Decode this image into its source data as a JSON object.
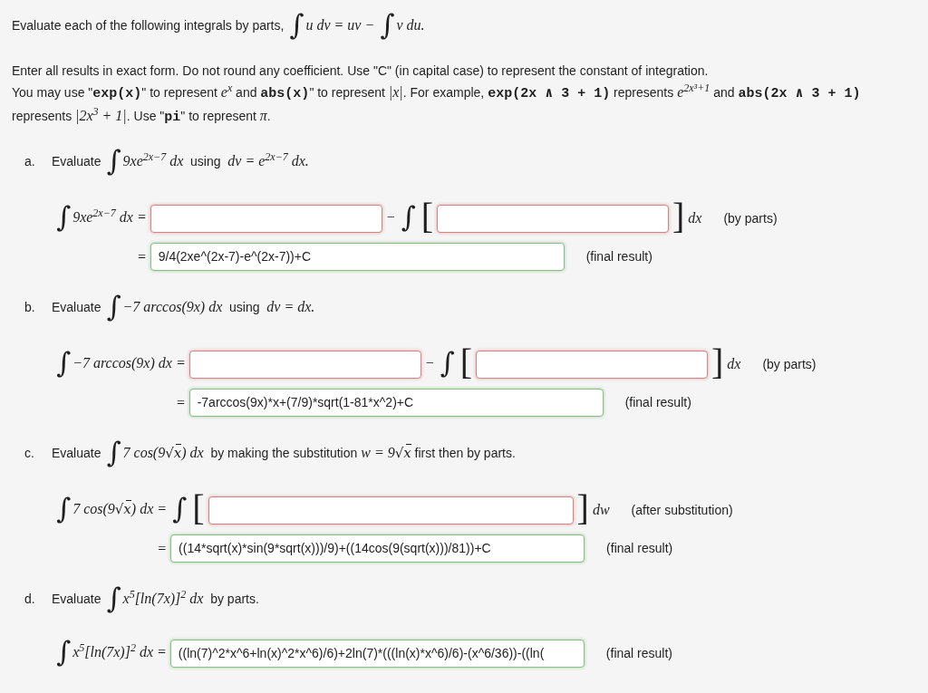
{
  "intro": [
    {
      "kind": "text",
      "text": "Evaluate each of the following integrals by parts, "
    },
    {
      "kind": "integral",
      "text": "∫"
    },
    {
      "kind": "math",
      "text": "u dv = uv − "
    },
    {
      "kind": "integral",
      "text": "∫"
    },
    {
      "kind": "math",
      "text": "v du."
    }
  ],
  "instructions": [
    [
      {
        "kind": "text",
        "text": "Enter all results in exact form. Do not round any coefficient. Use \"C\" (in capital case) to represent the constant of integration."
      }
    ],
    [
      {
        "kind": "text",
        "text": "You may use \""
      },
      {
        "kind": "code",
        "text": "exp(x)"
      },
      {
        "kind": "text",
        "text": "\" to represent "
      },
      {
        "kind": "math",
        "text": "e$^{x}$"
      },
      {
        "kind": "text",
        "text": " and "
      },
      {
        "kind": "code",
        "text": "abs(x)"
      },
      {
        "kind": "text",
        "text": "\" to represent "
      },
      {
        "kind": "math",
        "text": "|x|"
      },
      {
        "kind": "text",
        "text": ". For example, "
      },
      {
        "kind": "code",
        "text": "exp(2x ∧ 3 + 1)"
      },
      {
        "kind": "text",
        "text": " represents "
      },
      {
        "kind": "math",
        "text": "e$^{2x³+1}$"
      },
      {
        "kind": "text",
        "text": " and "
      },
      {
        "kind": "code",
        "text": "abs(2x ∧ 3 + 1)"
      },
      {
        "kind": "text",
        "text": " represents "
      },
      {
        "kind": "math",
        "text": "|2x$^{3}$ + 1|"
      },
      {
        "kind": "text",
        "text": ". Use \""
      },
      {
        "kind": "code",
        "text": "pi"
      },
      {
        "kind": "text",
        "text": "\" to represent "
      },
      {
        "kind": "math",
        "text": "π"
      },
      {
        "kind": "text",
        "text": "."
      }
    ]
  ],
  "parts": [
    {
      "label": "a.",
      "prompt": [
        {
          "kind": "text",
          "text": "Evaluate "
        },
        {
          "kind": "integral",
          "text": "∫"
        },
        {
          "kind": "math",
          "text": "9xe$^{2x−7}$ dx"
        },
        {
          "kind": "text",
          "text": "  using  "
        },
        {
          "kind": "math",
          "text": "dv = e$^{2x−7}$ dx."
        }
      ],
      "rows": [
        {
          "lhs": [
            {
              "kind": "integral",
              "text": "∫"
            },
            {
              "kind": "math",
              "text": "9xe$^{2x−7}$ dx ="
            }
          ],
          "items": [
            {
              "kind": "field",
              "correct": false
            },
            {
              "kind": "expr",
              "segments": [
                {
                  "kind": "math",
                  "text": "− "
                },
                {
                  "kind": "integral",
                  "text": "∫"
                }
              ]
            },
            {
              "kind": "bracket",
              "text": "["
            },
            {
              "kind": "field",
              "correct": false
            },
            {
              "kind": "bracket",
              "text": "]"
            },
            {
              "kind": "expr",
              "segments": [
                {
                  "kind": "math",
                  "text": "dx"
                }
              ]
            },
            {
              "kind": "note",
              "text": "(by parts)"
            }
          ]
        },
        {
          "lhs": [
            {
              "kind": "math",
              "text": "="
            }
          ],
          "items": [
            {
              "kind": "field",
              "correct": true,
              "value": "9/4(2xe^(2x-7)-e^(2x-7))+C"
            },
            {
              "kind": "note",
              "text": "(final result)"
            }
          ]
        }
      ]
    },
    {
      "label": "b.",
      "prompt": [
        {
          "kind": "text",
          "text": "Evaluate "
        },
        {
          "kind": "integral",
          "text": "∫"
        },
        {
          "kind": "math",
          "text": "−7 arccos(9x) dx"
        },
        {
          "kind": "text",
          "text": "  using  "
        },
        {
          "kind": "math",
          "text": "dv = dx."
        }
      ],
      "rows": [
        {
          "lhs": [
            {
              "kind": "integral",
              "text": "∫"
            },
            {
              "kind": "math",
              "text": "−7 arccos(9x) dx ="
            }
          ],
          "items": [
            {
              "kind": "field",
              "correct": false
            },
            {
              "kind": "expr",
              "segments": [
                {
                  "kind": "math",
                  "text": "− "
                },
                {
                  "kind": "integral",
                  "text": "∫"
                }
              ]
            },
            {
              "kind": "bracket",
              "text": "["
            },
            {
              "kind": "field",
              "correct": false
            },
            {
              "kind": "bracket",
              "text": "]"
            },
            {
              "kind": "expr",
              "segments": [
                {
                  "kind": "math",
                  "text": "dx"
                }
              ]
            },
            {
              "kind": "note",
              "text": "(by parts)"
            }
          ]
        },
        {
          "lhs": [
            {
              "kind": "math",
              "text": "="
            }
          ],
          "items": [
            {
              "kind": "field",
              "correct": true,
              "value": "-7arccos(9x)*x+(7/9)*sqrt(1-81*x^2)+C"
            },
            {
              "kind": "note",
              "text": "(final result)"
            }
          ]
        }
      ]
    },
    {
      "label": "c.",
      "prompt": [
        {
          "kind": "text",
          "text": "Evaluate "
        },
        {
          "kind": "integral",
          "text": "∫"
        },
        {
          "kind": "math",
          "text": "7 cos(9"
        },
        {
          "kind": "sqrt",
          "text": "√x"
        },
        {
          "kind": "math",
          "text": ") dx"
        },
        {
          "kind": "text",
          "text": "  by making the substitution "
        },
        {
          "kind": "math",
          "text": "w = 9"
        },
        {
          "kind": "sqrt",
          "text": "√x"
        },
        {
          "kind": "text",
          "text": " first then by parts."
        }
      ],
      "rows": [
        {
          "lhs": [
            {
              "kind": "integral",
              "text": "∫"
            },
            {
              "kind": "math",
              "text": "7 cos(9"
            },
            {
              "kind": "sqrt",
              "text": "√x"
            },
            {
              "kind": "math",
              "text": ") dx ="
            }
          ],
          "items": [
            {
              "kind": "expr",
              "segments": [
                {
                  "kind": "integral",
                  "text": "∫"
                }
              ]
            },
            {
              "kind": "bracket",
              "text": "["
            },
            {
              "kind": "field",
              "correct": false
            },
            {
              "kind": "bracket",
              "text": "]"
            },
            {
              "kind": "expr",
              "segments": [
                {
                  "kind": "math",
                  "text": "dw"
                }
              ]
            },
            {
              "kind": "note",
              "text": "(after substitution)"
            }
          ]
        },
        {
          "lhs": [
            {
              "kind": "math",
              "text": "="
            }
          ],
          "items": [
            {
              "kind": "field",
              "correct": true,
              "value": "((14*sqrt(x)*sin(9*sqrt(x)))/9)+((14cos(9(sqrt(x)))/81))+C"
            },
            {
              "kind": "note",
              "text": "(final result)"
            }
          ]
        }
      ]
    },
    {
      "label": "d.",
      "prompt": [
        {
          "kind": "text",
          "text": "Evaluate "
        },
        {
          "kind": "integral",
          "text": "∫"
        },
        {
          "kind": "math",
          "text": "x$^{5}$[ln(7x)]$^{2}$ dx"
        },
        {
          "kind": "text",
          "text": "  by parts."
        }
      ],
      "rows": [
        {
          "lhs": [
            {
              "kind": "integral",
              "text": "∫"
            },
            {
              "kind": "math",
              "text": "x$^{5}$[ln(7x)]$^{2}$ dx ="
            }
          ],
          "items": [
            {
              "kind": "field",
              "correct": true,
              "value": "((ln(7)^2*x^6+ln(x)^2*x^6)/6)+2ln(7)*(((ln(x)*x^6)/6)-(x^6/36))-((ln("
            },
            {
              "kind": "note",
              "text": "(final result)"
            }
          ]
        }
      ]
    }
  ]
}
